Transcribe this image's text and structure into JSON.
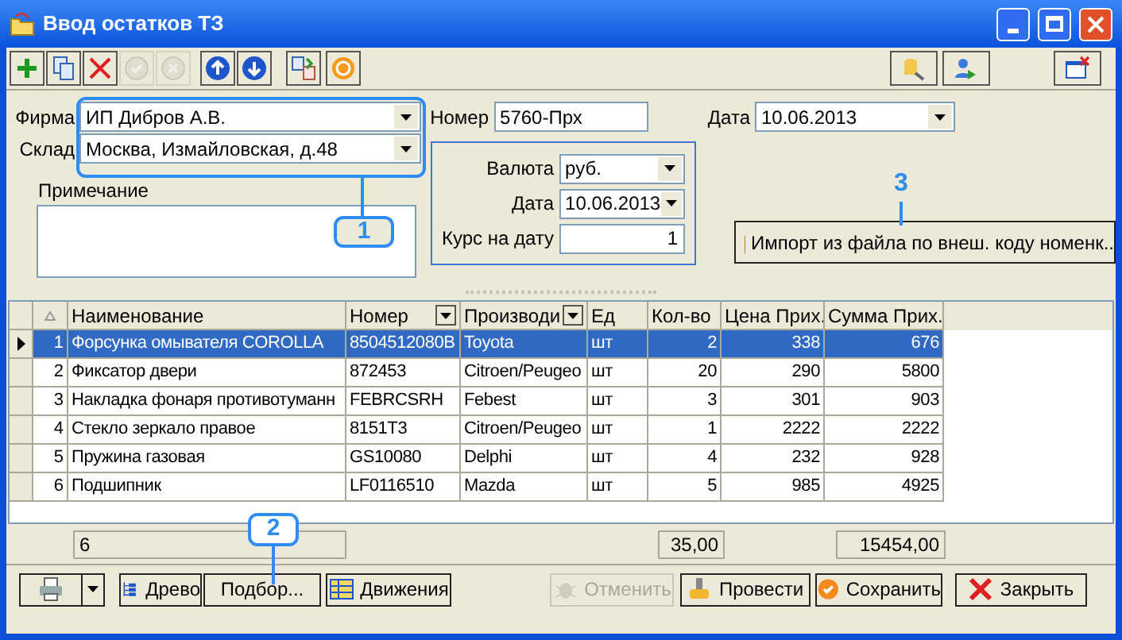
{
  "window": {
    "title": "Ввод остатков ТЗ"
  },
  "toolbar": [
    {
      "kind": "add",
      "disabled": false
    },
    {
      "kind": "copy",
      "disabled": false
    },
    {
      "kind": "delete",
      "disabled": false
    },
    {
      "kind": "confirm",
      "disabled": true
    },
    {
      "kind": "cancel",
      "disabled": true
    },
    {
      "kind": "up",
      "disabled": false
    },
    {
      "kind": "down",
      "disabled": false
    },
    {
      "kind": "transfer",
      "disabled": false
    },
    {
      "kind": "refresh",
      "disabled": false
    }
  ],
  "toolbar_right": [
    {
      "kind": "key"
    },
    {
      "kind": "users"
    },
    {
      "kind": "close-window"
    }
  ],
  "form": {
    "firm_label": "Фирма",
    "firm": "ИП Дибров А.В.",
    "warehouse_label": "Склад",
    "warehouse": "Москва, Измайловская, д.48",
    "note_label": "Примечание",
    "number_label": "Номер",
    "number": "5760-Прх",
    "date_label": "Дата",
    "date": "10.06.2013",
    "currency_group": {
      "currency_label": "Валюта",
      "currency": "руб.",
      "date_label": "Дата",
      "date": "10.06.2013",
      "rate_label": "Курс на дату",
      "rate": "1"
    },
    "import_button": "Импорт из файла по внеш. коду номенк.."
  },
  "table": {
    "columns": [
      {
        "label": "Наименование",
        "filter": false
      },
      {
        "label": "Номер",
        "filter": true
      },
      {
        "label": "Производи",
        "filter": true
      },
      {
        "label": "Ед",
        "filter": false
      },
      {
        "label": "Кол-во",
        "filter": false
      },
      {
        "label": "Цена Прих.",
        "filter": false
      },
      {
        "label": "Сумма Прих.",
        "filter": false
      }
    ],
    "rows": [
      {
        "selected": true,
        "number": "1",
        "cells": [
          "Форсунка омывателя COROLLA",
          "8504512080B",
          "Toyota",
          "шт",
          "2",
          "338",
          "676"
        ]
      },
      {
        "selected": false,
        "number": "2",
        "cells": [
          "Фиксатор двери",
          "872453",
          "Citroen/Peugeo",
          "шт",
          "20",
          "290",
          "5800"
        ]
      },
      {
        "selected": false,
        "number": "3",
        "cells": [
          "Накладка фонаря противотуманн",
          "FEBRCSRH",
          "Febest",
          "шт",
          "3",
          "301",
          "903"
        ]
      },
      {
        "selected": false,
        "number": "4",
        "cells": [
          "Стекло зеркало правое",
          "8151T3",
          "Citroen/Peugeo",
          "шт",
          "1",
          "2222",
          "2222"
        ]
      },
      {
        "selected": false,
        "number": "5",
        "cells": [
          "Пружина газовая",
          "GS10080",
          "Delphi",
          "шт",
          "4",
          "232",
          "928"
        ]
      },
      {
        "selected": false,
        "number": "6",
        "cells": [
          "Подшипник",
          "LF0116510",
          "Mazda",
          "шт",
          "5",
          "985",
          "4925"
        ]
      }
    ],
    "totals": {
      "count": "6",
      "quantity": "35,00",
      "sum": "15454,00"
    }
  },
  "buttons": [
    {
      "kind": "tree",
      "label": "Древо",
      "disabled": false
    },
    {
      "kind": "plain",
      "label": "Подбор...",
      "disabled": false
    },
    {
      "kind": "movements",
      "label": "Движения",
      "disabled": false
    },
    {
      "kind": "undo",
      "label": "Отменить",
      "disabled": true
    },
    {
      "kind": "post",
      "label": "Провести",
      "disabled": false
    },
    {
      "kind": "save",
      "label": "Сохранить",
      "disabled": false
    },
    {
      "kind": "close",
      "label": "Закрыть",
      "disabled": false
    }
  ],
  "callouts": [
    "1",
    "2",
    "3"
  ]
}
